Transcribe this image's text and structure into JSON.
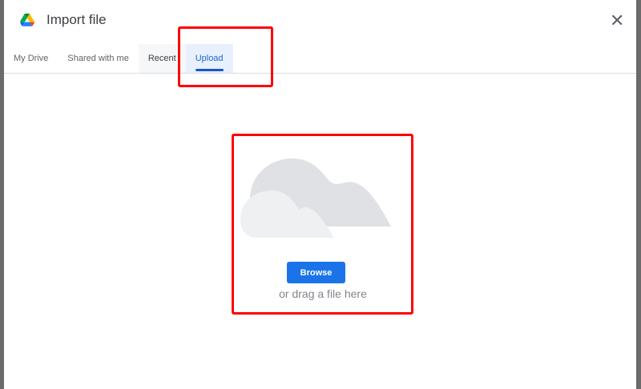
{
  "dialog": {
    "title": "Import file",
    "close_icon": "close-icon",
    "logo_icon": "google-drive-icon"
  },
  "tabs": [
    {
      "label": "My Drive"
    },
    {
      "label": "Shared with me"
    },
    {
      "label": "Recent"
    },
    {
      "label": "Upload",
      "active": true
    }
  ],
  "upload": {
    "browse_label": "Browse",
    "drag_text": "or drag a file here",
    "illustration_icon": "cloud-icon"
  },
  "colors": {
    "accent": "#1a73e8",
    "highlight": "#ff0000"
  }
}
